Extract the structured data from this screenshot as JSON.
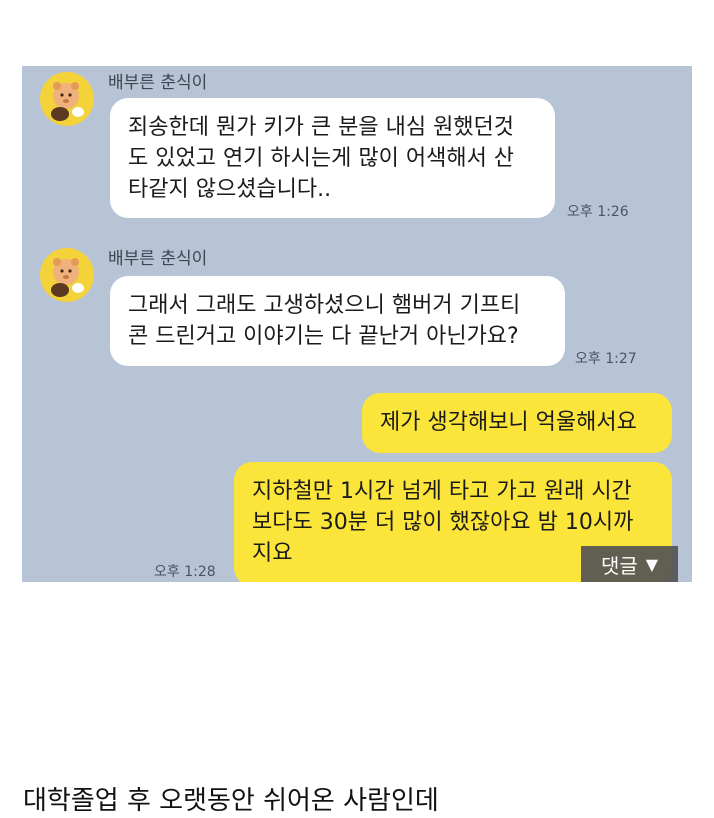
{
  "chat": {
    "messages": [
      {
        "sender": "배부른 춘식이",
        "lines": [
          "죄송한데 뭔가 키가 큰 분을 내심 원했던것",
          "도 있었고 연기 하시는게 많이 어색해서 산",
          "타같지 않으셨습니다.."
        ],
        "time": "오후 1:26"
      },
      {
        "sender": "배부른 춘식이",
        "lines": [
          "그래서 그래도 고생하셨으니 햄버거 기프티",
          "콘 드린거고 이야기는 다 끝난거 아닌가요?"
        ],
        "time": "오후 1:27"
      },
      {
        "lines": [
          "제가 생각해보니 억울해서요"
        ]
      },
      {
        "lines": [
          "지하철만 1시간 넘게 타고 가고 원래 시간",
          "보다도 30분 더 많이 했잖아요 밤 10시까",
          "지요"
        ],
        "time": "오후 1:28"
      }
    ],
    "reply_button": {
      "label": "댓글",
      "icon": "triangle-down-icon"
    }
  },
  "caption": "대학졸업 후 오랫동안 쉬어온 사람인데",
  "colors": {
    "chat_bg": "#b6c4d6",
    "sent_bubble": "#fce53b",
    "received_bubble": "#ffffff"
  }
}
